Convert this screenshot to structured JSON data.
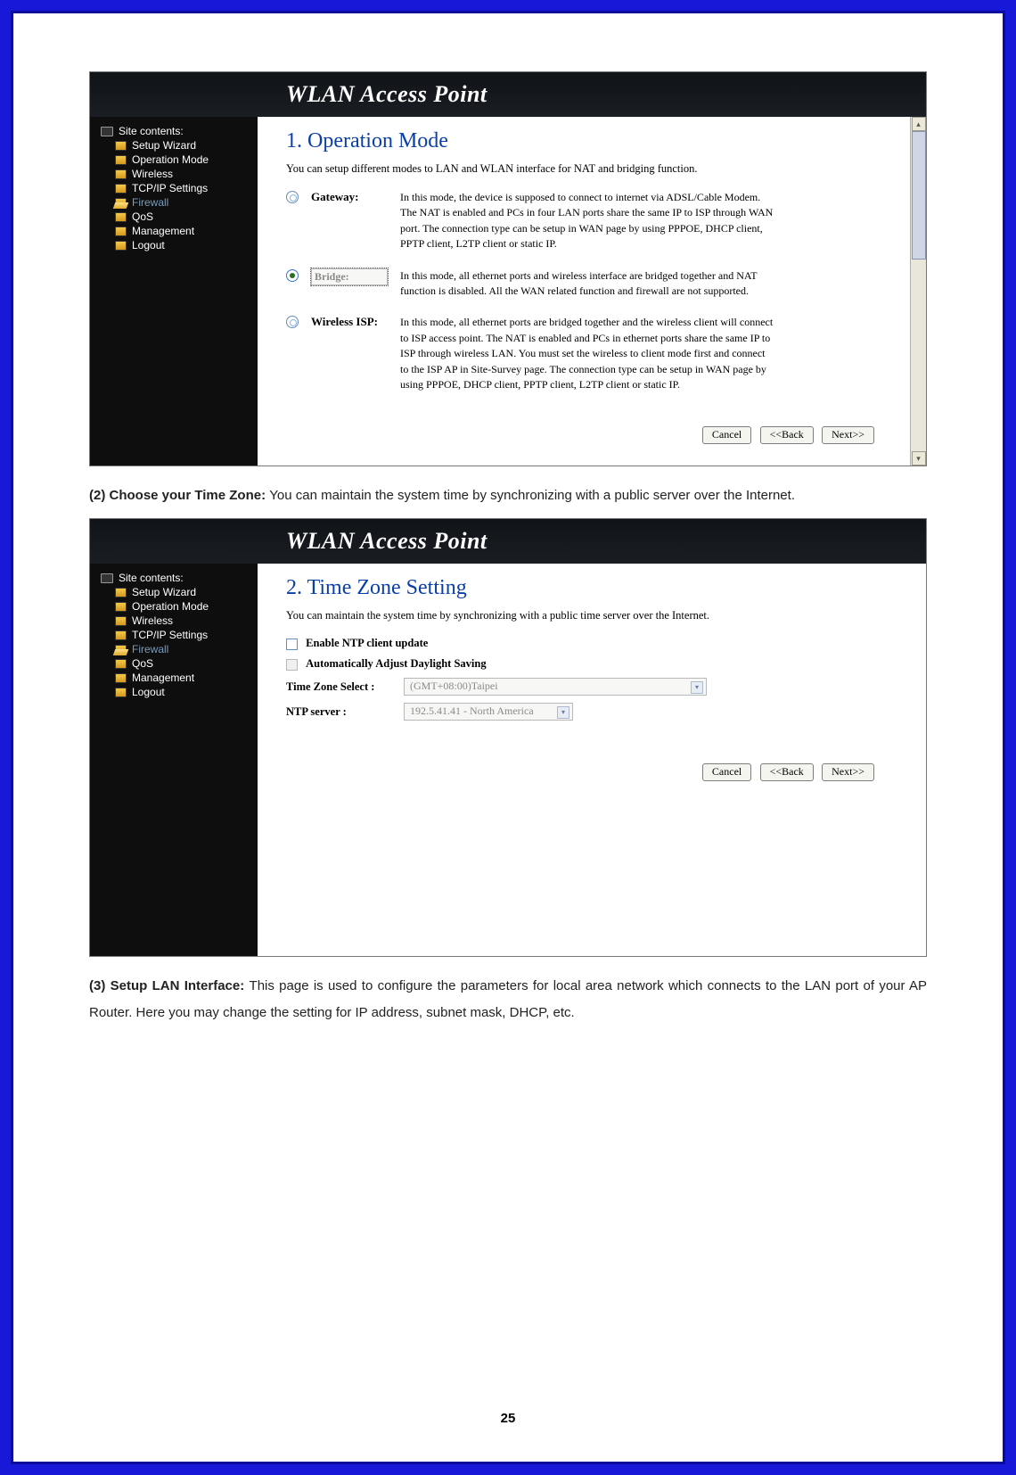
{
  "page_number": "25",
  "doc_paragraphs": {
    "p2_lead": "(2) Choose your Time Zone: ",
    "p2_rest": "You can maintain the system time by synchronizing with a public server over the Internet.",
    "p3_lead": "(3) Setup LAN Interface: ",
    "p3_rest": "This page is used to configure the parameters for local area network which connects to the LAN port of your AP Router. Here you may change the setting for IP address, subnet mask, DHCP, etc."
  },
  "common": {
    "header_title": "WLAN Access Point",
    "buttons": {
      "cancel": "Cancel",
      "back": "<<Back",
      "next": "Next>>"
    }
  },
  "sidebar": {
    "root": "Site contents:",
    "items": [
      {
        "label": "Setup Wizard",
        "dim": false
      },
      {
        "label": "Operation Mode",
        "dim": false
      },
      {
        "label": "Wireless",
        "dim": false
      },
      {
        "label": "TCP/IP Settings",
        "dim": false
      },
      {
        "label": "Firewall",
        "dim": true
      },
      {
        "label": "QoS",
        "dim": false
      },
      {
        "label": "Management",
        "dim": false
      },
      {
        "label": "Logout",
        "dim": false
      }
    ]
  },
  "shot1": {
    "title": "1. Operation Mode",
    "subtitle": "You can setup different modes to LAN and WLAN interface for NAT and bridging function.",
    "modes": [
      {
        "name": "Gateway:",
        "selected": false,
        "desc": "In this mode, the device is supposed to connect to internet via ADSL/Cable Modem. The NAT is enabled and PCs in four LAN ports share the same IP to ISP through WAN port. The connection type can be setup in WAN page by using PPPOE, DHCP client, PPTP client, L2TP client or static IP."
      },
      {
        "name": "Bridge:",
        "selected": true,
        "desc": "In this mode, all ethernet ports and wireless interface are bridged together and NAT function is disabled. All the WAN related function and firewall are not supported."
      },
      {
        "name": "Wireless ISP:",
        "selected": false,
        "desc": "In this mode, all ethernet ports are bridged together and the wireless client will connect to ISP access point. The NAT is enabled and PCs in ethernet ports share the same IP to ISP through wireless LAN. You must set the wireless to client mode first and connect to the ISP AP in Site-Survey page. The connection type can be setup in WAN page by using PPPOE, DHCP client, PPTP client, L2TP client or static IP."
      }
    ]
  },
  "shot2": {
    "title": "2. Time Zone Setting",
    "subtitle": "You can maintain the system time by synchronizing with a public time server over the Internet.",
    "chk_ntp": "Enable NTP client update",
    "chk_dst": "Automatically Adjust Daylight Saving",
    "tz_label": "Time Zone Select :",
    "tz_value": "(GMT+08:00)Taipei",
    "ntp_label": "NTP server :",
    "ntp_value": "192.5.41.41 - North America"
  }
}
